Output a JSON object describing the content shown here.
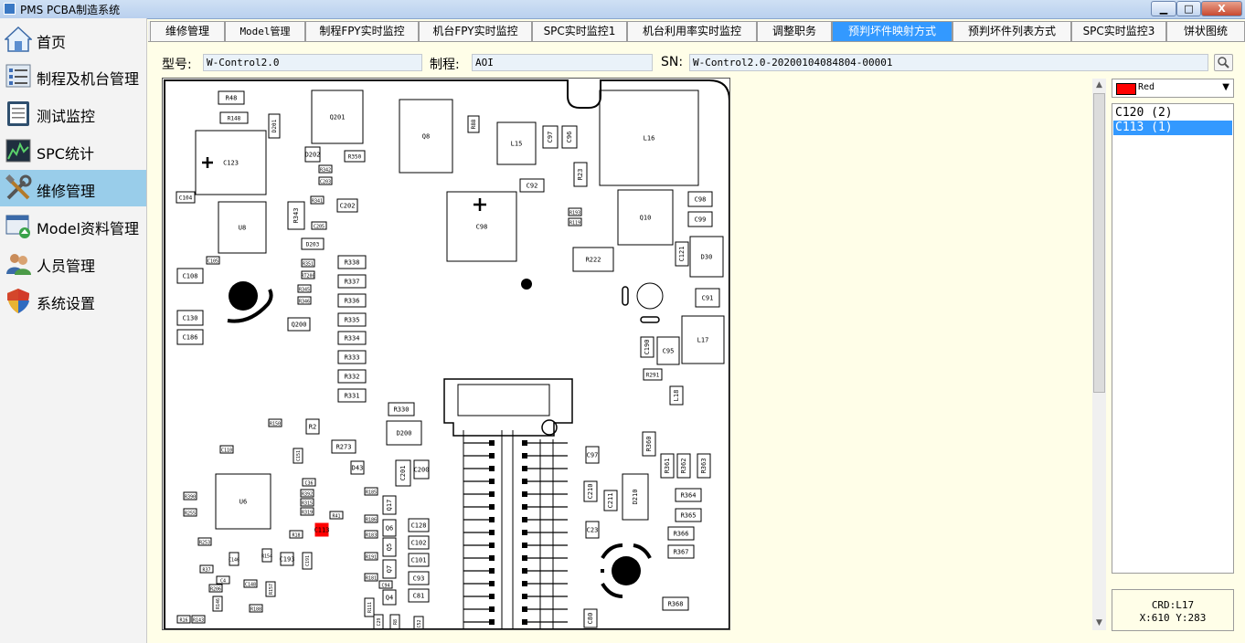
{
  "window": {
    "title": "PMS PCBA制造系统",
    "min_label": "▁",
    "max_label": "□",
    "close_label": "X"
  },
  "sidebar": {
    "items": [
      {
        "label": "首页",
        "icon": "home-icon",
        "active": false
      },
      {
        "label": "制程及机台管理",
        "icon": "list-icon",
        "active": false
      },
      {
        "label": "测试监控",
        "icon": "checklist-icon",
        "active": false
      },
      {
        "label": "SPC统计",
        "icon": "chart-icon",
        "active": false
      },
      {
        "label": "维修管理",
        "icon": "tools-icon",
        "active": true
      },
      {
        "label": "Model资料管理",
        "icon": "window-add-icon",
        "active": false
      },
      {
        "label": "人员管理",
        "icon": "users-icon",
        "active": false
      },
      {
        "label": "系统设置",
        "icon": "shield-icon",
        "active": false
      }
    ]
  },
  "tabs": [
    {
      "label": "维修管理",
      "active": false
    },
    {
      "label": "Model管理",
      "active": false
    },
    {
      "label": "制程FPY实时监控",
      "active": false
    },
    {
      "label": "机台FPY实时监控",
      "active": false
    },
    {
      "label": "SPC实时监控1",
      "active": false
    },
    {
      "label": "机台利用率实时监控",
      "active": false
    },
    {
      "label": "调整职务",
      "active": false
    },
    {
      "label": "预判坏件映射方式",
      "active": true
    },
    {
      "label": "预判坏件列表方式",
      "active": false
    },
    {
      "label": "SPC实时监控3",
      "active": false
    },
    {
      "label": "饼状图统",
      "active": false
    }
  ],
  "form": {
    "model_label": "型号:",
    "model_value": "W-Control2.0",
    "process_label": "制程:",
    "process_value": "AOI",
    "sn_label": "SN:",
    "sn_value": "W-Control2.0-20200104084804-00001"
  },
  "color_select": {
    "label": "Red",
    "color": "#ff0000"
  },
  "defects": [
    {
      "label": "C120 (2)",
      "selected": false
    },
    {
      "label": "C113 (1)",
      "selected": true
    }
  ],
  "info": {
    "crd": "CRD:L17",
    "coords": "X:610 Y:283"
  },
  "board": {
    "highlight_color": "#ff0000",
    "boxes": [
      [
        "R48",
        238,
        99,
        28,
        14
      ],
      [
        "R148",
        240,
        122,
        30,
        12
      ],
      [
        "Q201",
        340,
        98,
        56,
        58
      ],
      [
        "D201",
        293,
        124,
        12,
        26
      ],
      [
        "R350",
        376,
        164,
        22,
        12
      ],
      [
        "C123",
        213,
        142,
        77,
        70
      ],
      [
        "D202",
        333,
        160,
        16,
        16
      ],
      [
        "R342",
        348,
        180,
        14,
        8
      ],
      [
        "C203",
        348,
        193,
        14,
        8
      ],
      [
        "Q8",
        436,
        108,
        58,
        80
      ],
      [
        "R88",
        511,
        126,
        12,
        18
      ],
      [
        "L15",
        543,
        133,
        42,
        46
      ],
      [
        "C97",
        593,
        137,
        16,
        24
      ],
      [
        "C96",
        614,
        137,
        16,
        24
      ],
      [
        "L16",
        655,
        98,
        108,
        104
      ],
      [
        "C92",
        568,
        195,
        26,
        14
      ],
      [
        "R23",
        627,
        177,
        14,
        26
      ],
      [
        "C104",
        192,
        209,
        20,
        12
      ],
      [
        "R341",
        339,
        214,
        14,
        8
      ],
      [
        "C202",
        368,
        217,
        22,
        14
      ],
      [
        "U8",
        238,
        220,
        52,
        56
      ],
      [
        "R343",
        314,
        220,
        18,
        30
      ],
      [
        "C98",
        752,
        209,
        26,
        16
      ],
      [
        "Q10",
        675,
        207,
        60,
        60
      ],
      [
        "C99",
        752,
        231,
        26,
        16
      ],
      [
        "C205",
        340,
        242,
        16,
        8
      ],
      [
        "R193",
        621,
        227,
        14,
        8
      ],
      [
        "R119",
        621,
        238,
        14,
        8
      ],
      [
        "C98b",
        488,
        209,
        76,
        76
      ],
      [
        "D203",
        329,
        260,
        24,
        12
      ],
      [
        "R222",
        626,
        270,
        44,
        26
      ],
      [
        "C121",
        738,
        264,
        14,
        26
      ],
      [
        "D30",
        754,
        258,
        36,
        44
      ],
      [
        "C105",
        225,
        280,
        14,
        8
      ],
      [
        "R351",
        329,
        283,
        14,
        8
      ],
      [
        "R338",
        369,
        279,
        30,
        14
      ],
      [
        "C108",
        193,
        293,
        28,
        16
      ],
      [
        "RT200",
        329,
        296,
        14,
        8
      ],
      [
        "R337",
        369,
        300,
        30,
        14
      ],
      [
        "R345",
        325,
        311,
        14,
        8
      ],
      [
        "R346",
        325,
        324,
        14,
        8
      ],
      [
        "R336",
        369,
        321,
        30,
        14
      ],
      [
        "C91",
        760,
        315,
        26,
        20
      ],
      [
        "C130",
        193,
        339,
        28,
        16
      ],
      [
        "R335",
        369,
        342,
        30,
        14
      ],
      [
        "Q200",
        314,
        347,
        24,
        14
      ],
      [
        "C186",
        193,
        360,
        28,
        16
      ],
      [
        "R334",
        369,
        362,
        30,
        14
      ],
      [
        "C190",
        700,
        368,
        14,
        22
      ],
      [
        "C95",
        718,
        368,
        24,
        30
      ],
      [
        "L17",
        745,
        345,
        46,
        52
      ],
      [
        "R333",
        369,
        383,
        30,
        14
      ],
      [
        "R291",
        703,
        403,
        20,
        12
      ],
      [
        "R332",
        369,
        404,
        30,
        14
      ],
      [
        "L18",
        732,
        422,
        14,
        20
      ],
      [
        "R331",
        369,
        425,
        30,
        14
      ],
      [
        "R330",
        424,
        440,
        28,
        14
      ],
      [
        "D200",
        422,
        460,
        38,
        26
      ],
      [
        "R150",
        293,
        458,
        14,
        8
      ],
      [
        "R2",
        334,
        458,
        14,
        16
      ],
      [
        "R360",
        702,
        472,
        14,
        26
      ],
      [
        "C110",
        240,
        487,
        14,
        8
      ],
      [
        "C151",
        320,
        490,
        10,
        16
      ],
      [
        "R273",
        362,
        481,
        26,
        14
      ],
      [
        "C97b",
        640,
        488,
        14,
        18
      ],
      [
        "R361",
        722,
        496,
        14,
        26
      ],
      [
        "R362",
        740,
        496,
        14,
        26
      ],
      [
        "R363",
        762,
        496,
        14,
        26
      ],
      [
        "C201",
        432,
        503,
        16,
        28
      ],
      [
        "C200",
        452,
        503,
        16,
        20
      ],
      [
        "D43",
        383,
        504,
        14,
        14
      ],
      [
        "U6",
        235,
        518,
        60,
        60
      ],
      [
        "C36",
        330,
        523,
        14,
        8
      ],
      [
        "R392",
        328,
        535,
        14,
        8
      ],
      [
        "R315",
        328,
        545,
        14,
        8
      ],
      [
        "R319",
        328,
        555,
        14,
        8
      ],
      [
        "R185",
        398,
        533,
        14,
        8
      ],
      [
        "C210",
        638,
        526,
        14,
        22
      ],
      [
        "C211",
        660,
        536,
        14,
        22
      ],
      [
        "D210",
        680,
        518,
        28,
        50
      ],
      [
        "R364",
        738,
        534,
        28,
        14
      ],
      [
        "R365",
        738,
        556,
        28,
        14
      ],
      [
        "R390",
        200,
        538,
        14,
        8
      ],
      [
        "Q17",
        418,
        542,
        14,
        20
      ],
      [
        "R41",
        360,
        559,
        14,
        8
      ],
      [
        "R186",
        398,
        563,
        14,
        8
      ],
      [
        "C128",
        446,
        567,
        22,
        14
      ],
      [
        "C23",
        640,
        570,
        14,
        18
      ],
      [
        "R366",
        730,
        576,
        28,
        14
      ],
      [
        "R255",
        200,
        556,
        14,
        8
      ],
      [
        "C113",
        344,
        572,
        14,
        14
      ],
      [
        "Q6",
        418,
        568,
        14,
        18
      ],
      [
        "R183",
        398,
        580,
        14,
        8
      ],
      [
        "C102",
        446,
        586,
        22,
        14
      ],
      [
        "R18",
        316,
        580,
        14,
        8
      ],
      [
        "R253",
        216,
        588,
        14,
        8
      ],
      [
        "R367",
        730,
        596,
        28,
        14
      ],
      [
        "R191",
        398,
        604,
        14,
        8
      ],
      [
        "Q5",
        418,
        588,
        14,
        20
      ],
      [
        "C101",
        446,
        605,
        22,
        14
      ],
      [
        "R37",
        218,
        618,
        14,
        8
      ],
      [
        "C146",
        250,
        604,
        10,
        14
      ],
      [
        "C193",
        306,
        604,
        14,
        14
      ],
      [
        "C191",
        330,
        604,
        10,
        18
      ],
      [
        "R154",
        286,
        600,
        10,
        14
      ],
      [
        "Q7",
        418,
        612,
        14,
        20
      ],
      [
        "C93",
        446,
        625,
        22,
        14
      ],
      [
        "C4",
        236,
        630,
        14,
        8
      ],
      [
        "C148",
        266,
        634,
        14,
        8
      ],
      [
        "C94",
        414,
        635,
        14,
        8
      ],
      [
        "R206",
        228,
        639,
        14,
        8
      ],
      [
        "R157",
        290,
        636,
        10,
        16
      ],
      [
        "R181",
        398,
        627,
        14,
        8
      ],
      [
        "C81",
        446,
        644,
        22,
        14
      ],
      [
        "Q4",
        418,
        645,
        14,
        16
      ],
      [
        "R146",
        232,
        652,
        10,
        16
      ],
      [
        "R188",
        272,
        661,
        14,
        8
      ],
      [
        "R368",
        724,
        653,
        28,
        14
      ],
      [
        "R111",
        398,
        654,
        10,
        20
      ],
      [
        "C80",
        638,
        666,
        14,
        20
      ],
      [
        "C29",
        408,
        672,
        10,
        16
      ],
      [
        "R8",
        426,
        672,
        10,
        16
      ],
      [
        "C52",
        452,
        674,
        10,
        16
      ],
      [
        "R16",
        193,
        673,
        14,
        8
      ],
      [
        "R143",
        209,
        673,
        14,
        8
      ]
    ]
  }
}
